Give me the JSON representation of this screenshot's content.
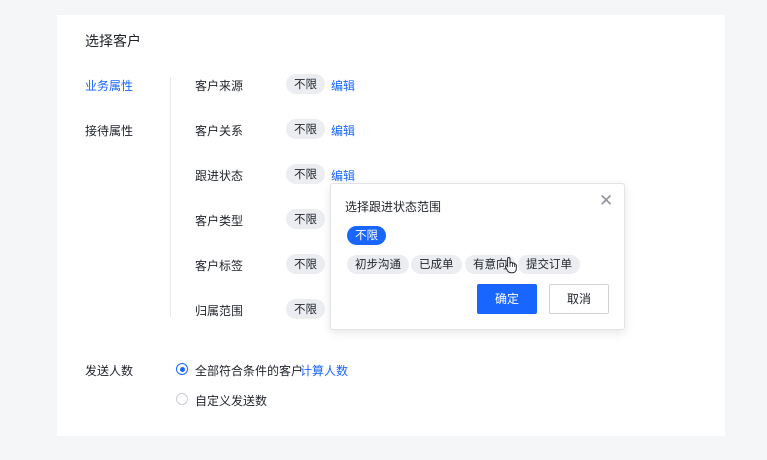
{
  "page": {
    "title": "选择客户"
  },
  "nav": {
    "items": [
      {
        "label": "业务属性",
        "active": true
      },
      {
        "label": "接待属性",
        "active": false
      }
    ]
  },
  "filters": {
    "rows": [
      {
        "label": "客户来源",
        "value": "不限",
        "edit": "编辑"
      },
      {
        "label": "客户关系",
        "value": "不限",
        "edit": "编辑"
      },
      {
        "label": "跟进状态",
        "value": "不限",
        "edit": "编辑"
      },
      {
        "label": "客户类型",
        "value": "不限"
      },
      {
        "label": "客户标签",
        "value": "不限"
      },
      {
        "label": "归属范围",
        "value": "不限"
      }
    ]
  },
  "popover": {
    "title": "选择跟进状态范围",
    "close_icon": "close-icon",
    "selected_option": "不限",
    "options": [
      "初步沟通",
      "已成单",
      "有意向",
      "提交订单"
    ],
    "confirm_label": "确定",
    "cancel_label": "取消"
  },
  "send": {
    "label": "发送人数",
    "option_all": "全部符合条件的客户",
    "calc_link": "计算人数",
    "option_custom": "自定义发送数"
  },
  "colors": {
    "accent": "#1966ff",
    "pill_bg": "#ebedf0",
    "page_bg": "#f5f6f8"
  }
}
